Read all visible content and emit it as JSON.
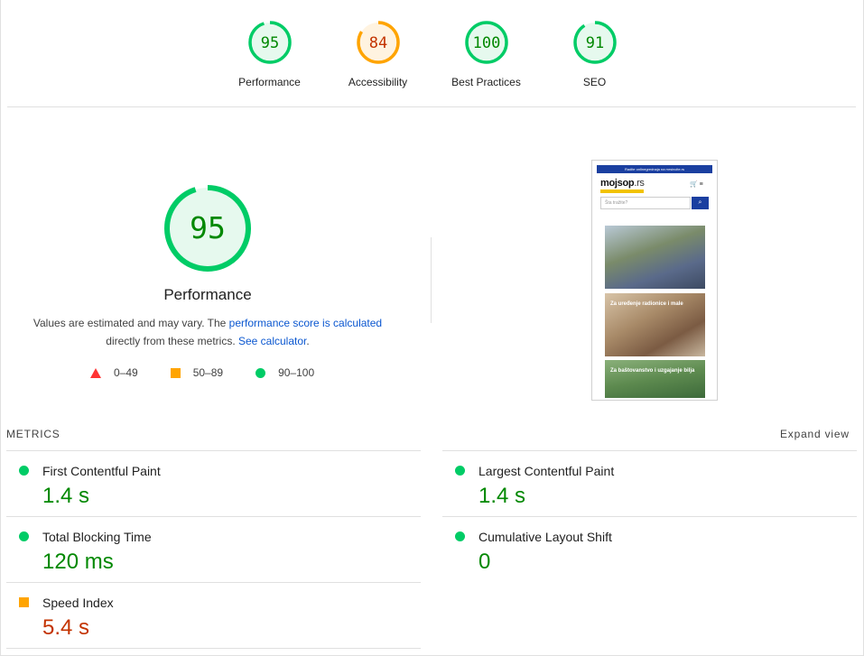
{
  "colors": {
    "pass": "#0c6",
    "pass_text": "#008800",
    "average": "#ffa400",
    "average_text": "#c33300",
    "fail": "#ff3333"
  },
  "top_gauges": [
    {
      "score": "95",
      "label": "Performance",
      "rating": "pass"
    },
    {
      "score": "84",
      "label": "Accessibility",
      "rating": "average"
    },
    {
      "score": "100",
      "label": "Best Practices",
      "rating": "pass"
    },
    {
      "score": "91",
      "label": "SEO",
      "rating": "pass"
    }
  ],
  "main": {
    "score": "95",
    "title": "Performance",
    "desc_prefix": "Values are estimated and may vary. The ",
    "desc_link1": "performance score is calculated",
    "desc_mid": " directly from these metrics. ",
    "desc_link2": "See calculator",
    "desc_suffix": "."
  },
  "legend": [
    {
      "shape": "triangle",
      "range": "0–49"
    },
    {
      "shape": "square",
      "range": "50–89"
    },
    {
      "shape": "circle",
      "range": "90–100"
    }
  ],
  "screenshot": {
    "banner": "Radite onlinegrednaja na mrsincite.rs",
    "logo_main": "mojsop",
    "logo_tld": ".rs",
    "search_placeholder": "Šta tražite?",
    "cap2": "Za uređenje radionice i male",
    "cap3": "Za baštovanstvo i uzgajanje bilja"
  },
  "metrics": {
    "heading": "METRICS",
    "expand": "Expand view",
    "left": [
      {
        "name": "First Contentful Paint",
        "value": "1.4 s",
        "rating": "pass"
      },
      {
        "name": "Total Blocking Time",
        "value": "120 ms",
        "rating": "pass"
      },
      {
        "name": "Speed Index",
        "value": "5.4 s",
        "rating": "average"
      }
    ],
    "right": [
      {
        "name": "Largest Contentful Paint",
        "value": "1.4 s",
        "rating": "pass"
      },
      {
        "name": "Cumulative Layout Shift",
        "value": "0",
        "rating": "pass"
      }
    ]
  }
}
